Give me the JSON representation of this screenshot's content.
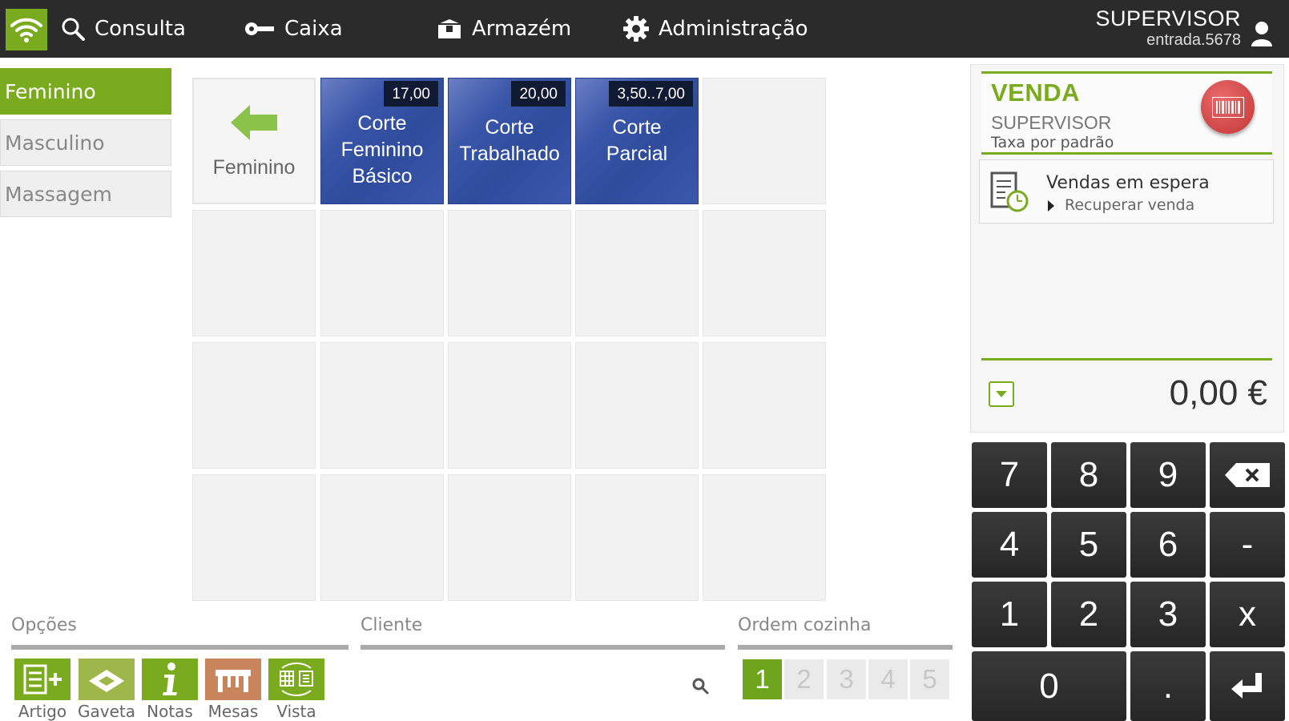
{
  "nav": {
    "items": [
      {
        "label": "Consulta",
        "icon": "search-icon"
      },
      {
        "label": "Caixa",
        "icon": "key-icon"
      },
      {
        "label": "Armazém",
        "icon": "box-icon"
      },
      {
        "label": "Administração",
        "icon": "gear-icon"
      }
    ],
    "user": {
      "name": "SUPERVISOR",
      "terminal": "entrada.5678"
    }
  },
  "categories": [
    "Feminino",
    "Masculino",
    "Massagem"
  ],
  "products": {
    "back_label": "Feminino",
    "items": [
      {
        "name": "Corte\nFeminino\nBásico",
        "price": "17,00"
      },
      {
        "name": "Corte\nTrabalhado",
        "price": "20,00"
      },
      {
        "name": "Corte Parcial",
        "price": "3,50..7,00"
      }
    ]
  },
  "options": {
    "label": "Opções",
    "buttons": [
      {
        "label": "Artigo",
        "icon": "add-article-icon"
      },
      {
        "label": "Gaveta",
        "icon": "drawer-icon"
      },
      {
        "label": "Notas",
        "icon": "info-icon"
      },
      {
        "label": "Mesas",
        "icon": "table-icon"
      },
      {
        "label": "Vista",
        "icon": "view-switch-icon"
      }
    ]
  },
  "client": {
    "label": "Cliente"
  },
  "kitchen": {
    "label": "Ordem cozinha",
    "orders": [
      "1",
      "2",
      "3",
      "4",
      "5"
    ],
    "selected": "1"
  },
  "sale": {
    "title": "VENDA",
    "user": "SUPERVISOR",
    "tax": "Taxa por padrão",
    "hold_title": "Vendas em espera",
    "hold_action": "Recuperar venda",
    "total": "0,00 €"
  },
  "keypad": {
    "keys": [
      "7",
      "8",
      "9",
      "4",
      "5",
      "6",
      "-",
      "1",
      "2",
      "3",
      "x",
      "0",
      "."
    ]
  },
  "colors": {
    "accent": "#7aaa1e",
    "product_blue": "#2f4b9c",
    "topbar": "#2b2b2b"
  }
}
